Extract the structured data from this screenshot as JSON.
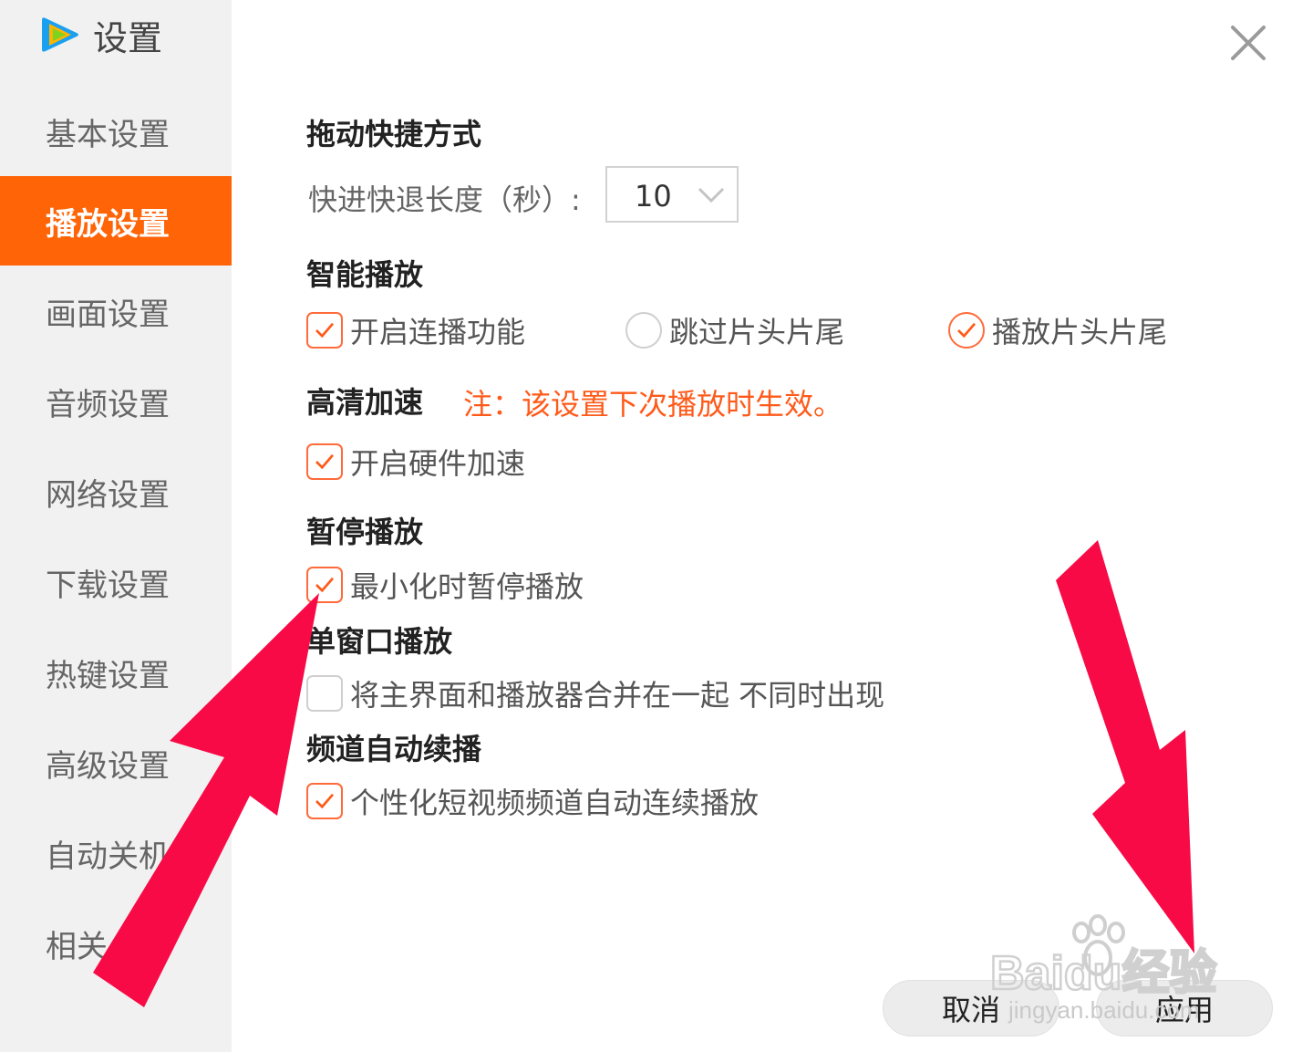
{
  "app": {
    "title": "设置",
    "logo_icon": "tencent-video-logo"
  },
  "sidebar": {
    "items": [
      {
        "label": "基本设置",
        "active": false
      },
      {
        "label": "播放设置",
        "active": true
      },
      {
        "label": "画面设置",
        "active": false
      },
      {
        "label": "音频设置",
        "active": false
      },
      {
        "label": "网络设置",
        "active": false
      },
      {
        "label": "下载设置",
        "active": false
      },
      {
        "label": "热键设置",
        "active": false
      },
      {
        "label": "高级设置",
        "active": false
      },
      {
        "label": "自动关机",
        "active": false
      },
      {
        "label": "相关",
        "active": false
      }
    ]
  },
  "sections": {
    "drag": {
      "title": "拖动快捷方式",
      "seek_label": "快进快退长度（秒）:",
      "seek_value": "10"
    },
    "smart": {
      "title": "智能播放",
      "continuous": {
        "label": "开启连播功能",
        "checked": true
      },
      "skip_intro": {
        "label": "跳过片头片尾",
        "selected": false
      },
      "play_intro": {
        "label": "播放片头片尾",
        "selected": true
      }
    },
    "hd": {
      "title": "高清加速",
      "note": "注：该设置下次播放时生效。",
      "hardware": {
        "label": "开启硬件加速",
        "checked": true
      }
    },
    "pause": {
      "title": "暂停播放",
      "minimize": {
        "label": "最小化时暂停播放",
        "checked": true
      }
    },
    "single_window": {
      "title": "单窗口播放",
      "merge": {
        "label": "将主界面和播放器合并在一起 不同时出现",
        "checked": false
      }
    },
    "channel": {
      "title": "频道自动续播",
      "autoplay": {
        "label": "个性化短视频频道自动连续播放",
        "checked": true
      }
    }
  },
  "buttons": {
    "cancel": "取消",
    "apply": "应用"
  },
  "watermark": {
    "brand": "Baidu经验",
    "url": "jingyan.baidu.com"
  },
  "colors": {
    "accent": "#ff6407",
    "note": "#ff5a1a",
    "arrow": "#f70a45"
  }
}
